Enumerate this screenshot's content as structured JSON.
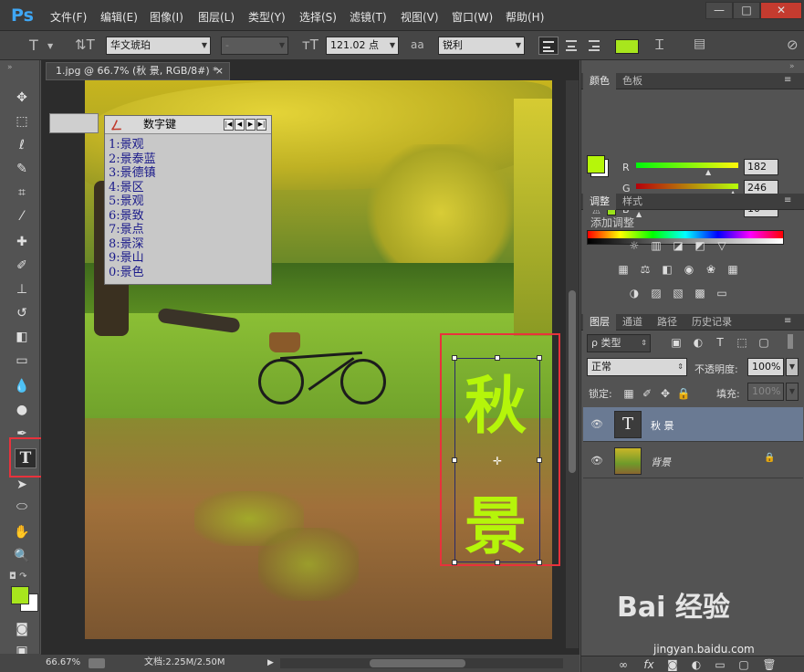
{
  "app": {
    "logo": "Ps",
    "menus": [
      "文件(F)",
      "编辑(E)",
      "图像(I)",
      "图层(L)",
      "类型(Y)",
      "选择(S)",
      "滤镜(T)",
      "视图(V)",
      "窗口(W)",
      "帮助(H)"
    ],
    "window_buttons": [
      "—",
      "□",
      "✕"
    ]
  },
  "options": {
    "font_family": "华文琥珀",
    "font_style": "-",
    "font_size": "121.02 点",
    "antialias_icon": "aa",
    "antialias": "锐利",
    "text_color": "#a8e61d"
  },
  "document": {
    "tab_label": "1.jpg @ 66.7% (秋 景, RGB/8#) *",
    "close": "×",
    "text_layer_chars": [
      "秋",
      "景"
    ],
    "text_color": "#b5f50a"
  },
  "ime": {
    "title": "数字键",
    "nav_buttons": [
      "|◀",
      "◀",
      "▶",
      "▶|"
    ],
    "lines": [
      "1:景观",
      "2:景泰蓝",
      "3:景德镇",
      "4:景区",
      "5:景观",
      "6:景致",
      "7:景点",
      "8:景深",
      "9:景山",
      "0:景色"
    ]
  },
  "toolbar": {
    "tools": [
      "move-icon",
      "marquee-icon",
      "lasso-icon",
      "quick-select-icon",
      "crop-icon",
      "eyedropper-icon",
      "healing-icon",
      "brush-icon",
      "stamp-icon",
      "history-brush-icon",
      "eraser-icon",
      "gradient-icon",
      "blur-icon",
      "dodge-icon",
      "pen-icon",
      "type-icon",
      "path-select-icon",
      "ellipse-icon",
      "hand-icon",
      "zoom-icon"
    ],
    "type_tool_glyph": "T",
    "foreground": "#a8e61d",
    "background": "#ffffff"
  },
  "status": {
    "zoom": "66.67%",
    "doc_info": "文档:2.25M/2.50M"
  },
  "color_panel": {
    "tabs": [
      "颜色",
      "色板"
    ],
    "r_label": "R",
    "r": "182",
    "g_label": "G",
    "g": "246",
    "b_label": "B",
    "b": "10",
    "swatch": "#b6f60a"
  },
  "adjust_panel": {
    "tabs": [
      "调整",
      "样式"
    ],
    "title": "添加调整"
  },
  "layers_panel": {
    "tabs": [
      "图层",
      "通道",
      "路径",
      "历史记录"
    ],
    "filter": "ρ 类型",
    "blend_mode": "正常",
    "opacity_label": "不透明度:",
    "opacity": "100%",
    "lock_label": "锁定:",
    "fill_label": "填充:",
    "fill": "100%",
    "layers": [
      {
        "name": "秋 景",
        "thumb_glyph": "T"
      },
      {
        "name": "背景"
      }
    ]
  },
  "watermark": {
    "text": "Bai 经验",
    "url": "jingyan.baidu.com"
  }
}
